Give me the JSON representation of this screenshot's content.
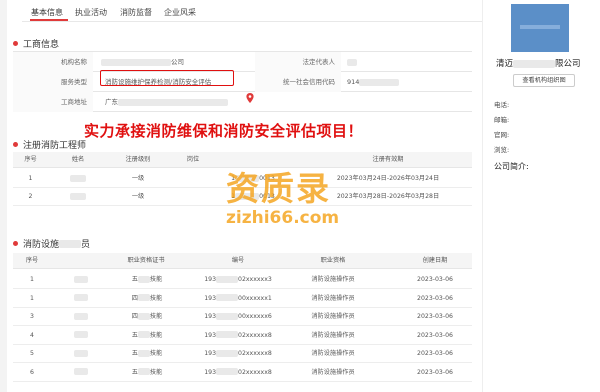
{
  "tabs": [
    "基本信息",
    "执业活动",
    "消防监督",
    "企业风采"
  ],
  "business": {
    "title": "工商信息",
    "org_name_label": "机构名称",
    "org_name_suffix": "公司",
    "legal_rep_label": "法定代表人",
    "service_type_label": "服务类型",
    "service_type_value": "消防设施维护保养检测/消防安全评估",
    "credit_code_label": "统一社会信用代码",
    "credit_code_prefix": "914",
    "address_label": "工商地址",
    "address_prefix": "广东"
  },
  "promo_text": "实力承接消防维保和消防安全评估项目！",
  "engineers": {
    "title": "注册消防工程师",
    "headers": [
      "序号",
      "姓名",
      "注册级别",
      "岗位",
      "",
      "注册有效期"
    ],
    "rows": [
      {
        "no": "1",
        "level": "一级",
        "id_prefix": "1",
        "id_suffix": "0013",
        "validity": "2023年03月24日-2026年03月24日"
      },
      {
        "no": "2",
        "level": "一级",
        "id_prefix": "1",
        "id_suffix": "0013",
        "validity": "2023年03月28日-2026年03月28日"
      }
    ]
  },
  "operators": {
    "title": "消防设施",
    "title_suffix": "员",
    "headers": [
      "序号",
      "",
      "职业资格证书",
      "编号",
      "职业资格",
      "创建日期"
    ],
    "rows": [
      {
        "no": "1",
        "cert": "五",
        "cert_tail": "技能",
        "code_prefix": "193",
        "code_suffix": "02xxxxxx3",
        "qual": "消防设施操作员",
        "date": "2023-03-06"
      },
      {
        "no": "1",
        "cert": "四",
        "cert_tail": "技能",
        "code_prefix": "193",
        "code_suffix": "00xxxxxx1",
        "qual": "消防设施操作员",
        "date": "2023-03-06"
      },
      {
        "no": "3",
        "cert": "四",
        "cert_tail": "技能",
        "code_prefix": "193",
        "code_suffix": "00xxxxxx6",
        "qual": "消防设施操作员",
        "date": "2023-03-06"
      },
      {
        "no": "4",
        "cert": "五",
        "cert_tail": "技能",
        "code_prefix": "193",
        "code_suffix": "02xxxxxx8",
        "qual": "消防设施操作员",
        "date": "2023-03-06"
      },
      {
        "no": "5",
        "cert": "五",
        "cert_tail": "技能",
        "code_prefix": "193",
        "code_suffix": "02xxxxxx8",
        "qual": "消防设施操作员",
        "date": "2023-03-06"
      },
      {
        "no": "6",
        "cert": "五",
        "cert_tail": "技能",
        "code_prefix": "193",
        "code_suffix": "02xxxxxx8",
        "qual": "消防设施操作员",
        "date": "2023-03-06"
      }
    ]
  },
  "watermark": {
    "main": "资质录",
    "url": "zizhi66.com"
  },
  "sidebar": {
    "company_prefix": "清迈",
    "company_suffix": "限公司",
    "map_button": "查看机构组织图",
    "phone_label": "电话:",
    "email_label": "邮箱:",
    "website_label": "官网:",
    "browse_label": "浏览:",
    "intro_label": "公司简介:"
  },
  "colors": {
    "accent": "#e03a3a",
    "promo": "#e01010",
    "watermark": "#f5a623",
    "logo": "#5b8fc8"
  }
}
